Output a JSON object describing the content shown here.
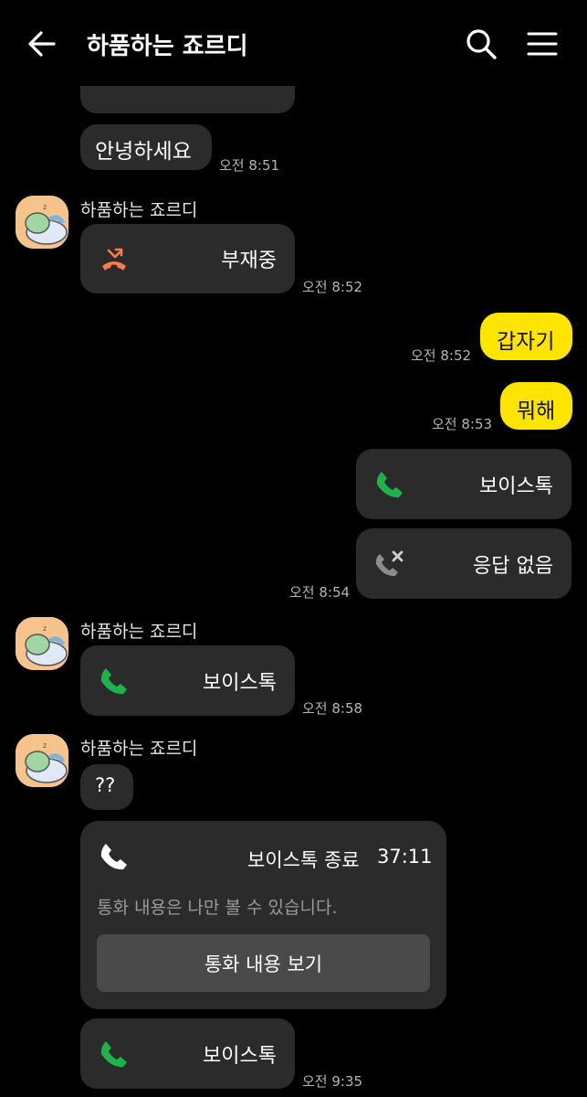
{
  "header": {
    "title": "하품하는 죠르디",
    "back_icon": "arrow-left-icon",
    "search_icon": "search-icon",
    "menu_icon": "hamburger-menu-icon"
  },
  "colors": {
    "background": "#000000",
    "bubble_dark": "#2b2b2b",
    "bubble_yellow": "#fee500",
    "missed_call_orange": "#ff7a4d",
    "call_green": "#1fb14a"
  },
  "messages": {
    "m1": {
      "text": "안녕하세요",
      "time": "오전 8:51"
    },
    "m2": {
      "sender": "하품하는 죠르디",
      "label": "부재중",
      "time": "오전 8:52",
      "icon": "missed-call-icon"
    },
    "m3": {
      "text": "갑자기",
      "time": "오전 8:52"
    },
    "m4": {
      "text": "뭐해",
      "time": "오전 8:53"
    },
    "m5": {
      "label": "보이스톡",
      "icon": "phone-icon"
    },
    "m6": {
      "label": "응답 없음",
      "time": "오전 8:54",
      "icon": "no-answer-call-icon"
    },
    "m7": {
      "sender": "하품하는 죠르디",
      "label": "보이스톡",
      "time": "오전 8:58",
      "icon": "phone-icon"
    },
    "m8": {
      "sender": "하품하는 죠르디",
      "text": "??"
    },
    "m9": {
      "title": "보이스톡 종료",
      "duration": "37:11",
      "note": "통화 내용은 나만 볼 수 있습니다.",
      "button": "통화 내용 보기",
      "icon": "phone-icon"
    },
    "m10": {
      "label": "보이스톡",
      "time": "오전 9:35",
      "icon": "phone-icon"
    }
  }
}
